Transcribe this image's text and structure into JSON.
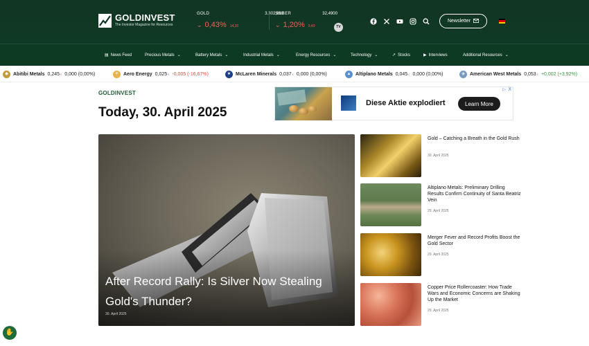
{
  "brand": {
    "name": "GOLDINVEST",
    "tagline": "The Investor Magazine for Resources"
  },
  "quotes": [
    {
      "name": "GOLD",
      "price": "3.302,690",
      "pct": "0,43%",
      "abs": "14,20"
    },
    {
      "name": "SILBER",
      "price": "32,4900",
      "pct": "1,20%",
      "abs": "0,40"
    }
  ],
  "tradingview": "TV",
  "header": {
    "newsletter_label": "Newsletter",
    "icons": [
      "facebook-icon",
      "x-icon",
      "youtube-icon",
      "instagram-icon",
      "search-icon"
    ]
  },
  "nav": {
    "items": [
      {
        "label": "News Feed",
        "icon": "news-feed-icon",
        "dropdown": false
      },
      {
        "label": "Precious Metals",
        "dropdown": true
      },
      {
        "label": "Battery Metals",
        "dropdown": true
      },
      {
        "label": "Industrial Metals",
        "dropdown": true
      },
      {
        "label": "Energy Resources",
        "dropdown": true
      },
      {
        "label": "Technology",
        "dropdown": true
      },
      {
        "label": "Stocks",
        "icon": "chart-icon",
        "dropdown": false
      },
      {
        "label": "Interviews",
        "icon": "video-icon",
        "dropdown": false
      },
      {
        "label": "Additional Resources",
        "dropdown": true
      }
    ]
  },
  "ticker": [
    {
      "name": "Abitibi Metals",
      "price": "0,245",
      "currency": "€",
      "change": "0,000 (0,00%)",
      "dir": "flat",
      "logo_color": "#c49a3a"
    },
    {
      "name": "Aero Energy",
      "price": "0,025",
      "currency": "€",
      "change": "-0,005 (-16,67%)",
      "dir": "neg",
      "logo_color": "#e8b44a"
    },
    {
      "name": "McLaren Minerals",
      "price": "0,037",
      "currency": "€",
      "change": "0,000 (0,00%)",
      "dir": "flat",
      "logo_color": "#1e3f8a"
    },
    {
      "name": "Altiplano Metals",
      "price": "0,045",
      "currency": "€",
      "change": "0,000 (0,00%)",
      "dir": "flat",
      "logo_color": "#5a8fd0"
    },
    {
      "name": "American West Metals",
      "price": "0,053",
      "currency": "€",
      "change": "+0,002 (+3,92%)",
      "dir": "pos",
      "logo_color": "#7a9bc0"
    }
  ],
  "main": {
    "brand_label": "GOLDINVEST",
    "date_title": "Today, 30. April 2025",
    "ad": {
      "text": "Diese Aktie explodiert",
      "button": "Learn More",
      "close": "X"
    },
    "hero": {
      "title": "After Record Rally: Is Silver Now Stealing Gold's Thunder?",
      "date": "30. April 2025"
    },
    "side_articles": [
      {
        "title": "Gold – Catching a Breath in the Gold Rush",
        "date": "30. April 2025"
      },
      {
        "title": "Altiplano Metals: Preliminary Drilling Results Confirm Continuity of Santa Beatriz Vein",
        "date": "29. April 2025"
      },
      {
        "title": "Merger Fever and Record Profits Boost the Gold Sector",
        "date": "29. April 2025"
      },
      {
        "title": "Copper Price Rollercoaster: How Trade Wars and Economic Concerns are Shaking Up the Market",
        "date": "29. April 2025"
      }
    ]
  },
  "colors": {
    "header_bg": "#123524",
    "nav_bg": "#0d3a22",
    "negative": "#e0463b",
    "positive": "#2a9d3f",
    "brand_green": "#1f5a34"
  }
}
